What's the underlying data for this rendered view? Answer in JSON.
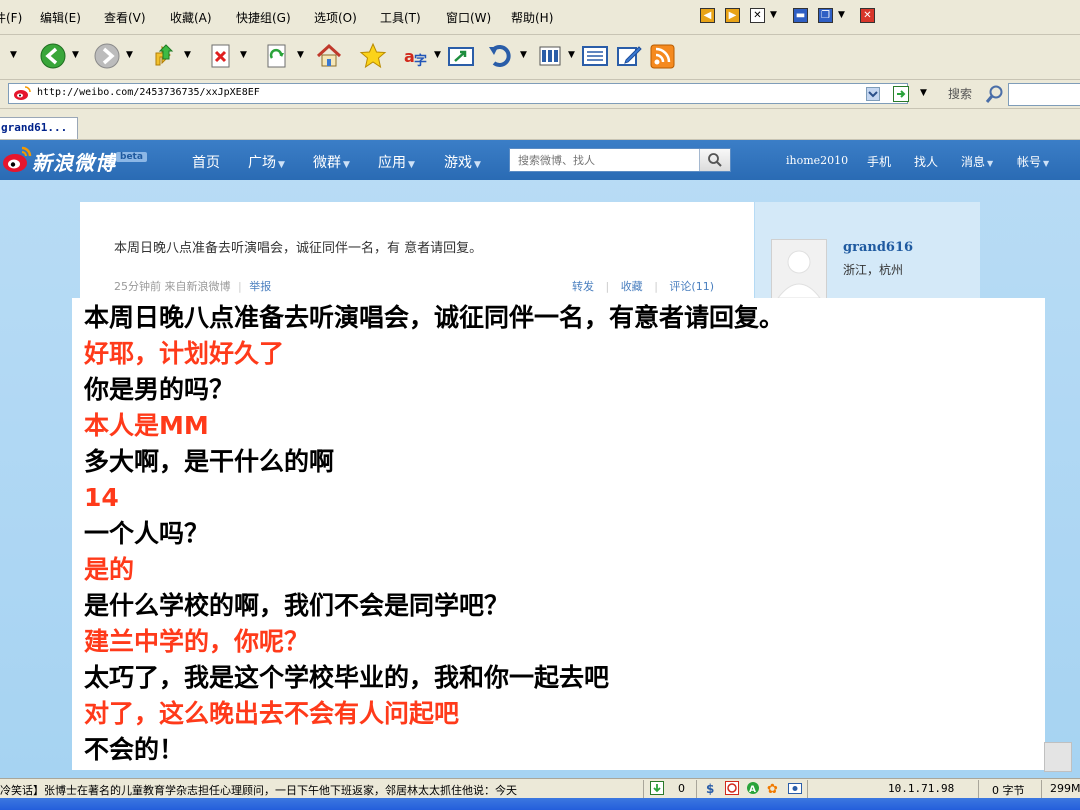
{
  "menubar": {
    "items": [
      "文件(F)",
      "编辑(E)",
      "查看(V)",
      "收藏(A)",
      "快捷组(G)",
      "选项(O)",
      "工具(T)",
      "窗口(W)",
      "帮助(H)"
    ]
  },
  "address": {
    "url": "http://weibo.com/2453736735/xxJpXE8EF",
    "search_label": "搜索"
  },
  "tab": {
    "title": "grand61..."
  },
  "weibo": {
    "logo": "新浪微博",
    "beta": "beta",
    "nav": [
      "首页",
      "广场",
      "微群",
      "应用",
      "游戏"
    ],
    "search_placeholder": "搜索微博、找人",
    "right_nav": [
      "ihome2010",
      "手机",
      "找人",
      "消息",
      "帐号"
    ],
    "post": {
      "text": "本周日晚八点准备去听演唱会，诚征同伴一名，有 意者请回复。",
      "time": "25分钟前",
      "source": "来自新浪微博",
      "report": "举报",
      "repost": "转发",
      "favorite": "收藏",
      "comment": "评论(11)"
    },
    "profile": {
      "name": "grand616",
      "location": "浙江，杭州"
    }
  },
  "dialog": {
    "lines": [
      {
        "text": "本周日晚八点准备去听演唱会，诚征同伴一名，有意者请回复。",
        "color": "black"
      },
      {
        "text": "好耶，计划好久了",
        "color": "red"
      },
      {
        "text": "你是男的吗？",
        "color": "black"
      },
      {
        "text": "本人是MM",
        "color": "red"
      },
      {
        "text": "多大啊，是干什么的啊",
        "color": "black"
      },
      {
        "text": "14",
        "color": "red"
      },
      {
        "text": "一个人吗？",
        "color": "black"
      },
      {
        "text": "是的",
        "color": "red"
      },
      {
        "text": "是什么学校的啊，我们不会是同学吧？",
        "color": "black"
      },
      {
        "text": "建兰中学的，你呢？",
        "color": "red"
      },
      {
        "text": "太巧了，我是这个学校毕业的，我和你一起去吧",
        "color": "black"
      },
      {
        "text": "对了，这么晚出去不会有人问起吧",
        "color": "red"
      },
      {
        "text": "不会的！",
        "color": "black"
      }
    ]
  },
  "status": {
    "ticker": "冷笑话】张博士在著名的儿童教育学杂志担任心理顾问，一日下午他下班返家，邻居林太太抓住他说：今天",
    "count": "0",
    "ip": "10.1.71.98",
    "bytes": "0 字节",
    "extra": "299M"
  },
  "colors": {
    "red_text": "#ff3a1a",
    "weibo_blue": "#2a6bb4"
  }
}
